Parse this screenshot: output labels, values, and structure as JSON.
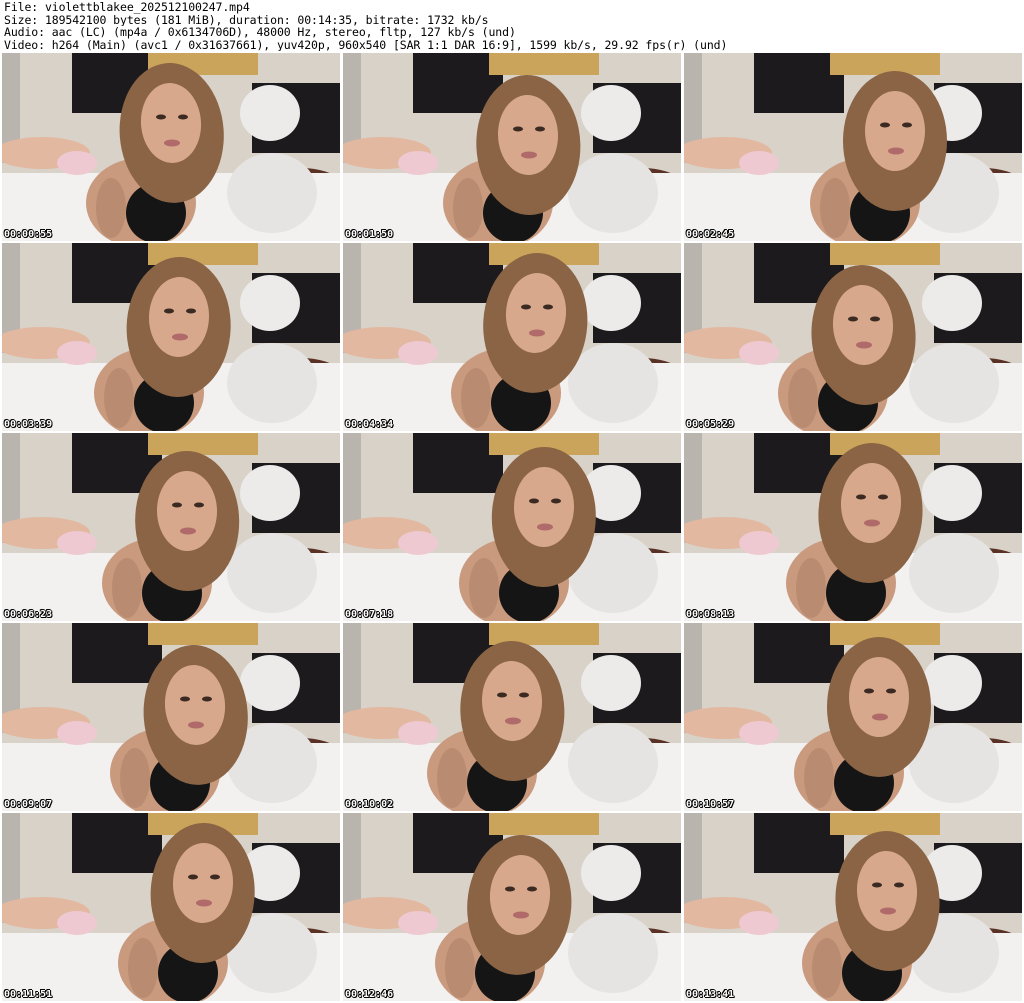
{
  "header": {
    "file_line": "File: violettblakee_202512100247.mp4",
    "size_line": "Size: 189542100 bytes (181 MiB), duration: 00:14:35, bitrate: 1732 kb/s",
    "audio_line": "Audio: aac (LC) (mp4a / 0x6134706D), 48000 Hz, stereo, fltp, 127 kb/s (und)",
    "video_line": "Video: h264 (Main) (avc1 / 0x31637661), yuv420p, 960x540 [SAR 1:1 DAR 16:9], 1599 kb/s, 29.92 fps(r) (und)"
  },
  "thumbnails": [
    {
      "timestamp": "00:00:55"
    },
    {
      "timestamp": "00:01:50"
    },
    {
      "timestamp": "00:02:45"
    },
    {
      "timestamp": "00:03:39"
    },
    {
      "timestamp": "00:04:34"
    },
    {
      "timestamp": "00:05:29"
    },
    {
      "timestamp": "00:06:23"
    },
    {
      "timestamp": "00:07:18"
    },
    {
      "timestamp": "00:08:13"
    },
    {
      "timestamp": "00:09:07"
    },
    {
      "timestamp": "00:10:02"
    },
    {
      "timestamp": "00:10:57"
    },
    {
      "timestamp": "00:11:51"
    },
    {
      "timestamp": "00:12:46"
    },
    {
      "timestamp": "00:13:41"
    }
  ],
  "colors": {
    "wall": "#d9d2c8",
    "headboard": "#1c1a1c",
    "pillow": "#ecebea",
    "bedding": "#f2f1f0",
    "blanket": "#5a3125",
    "hair": "#8a6444",
    "skin": "#c99a7e",
    "top": "#151515",
    "shorts": "#efc9d2"
  }
}
